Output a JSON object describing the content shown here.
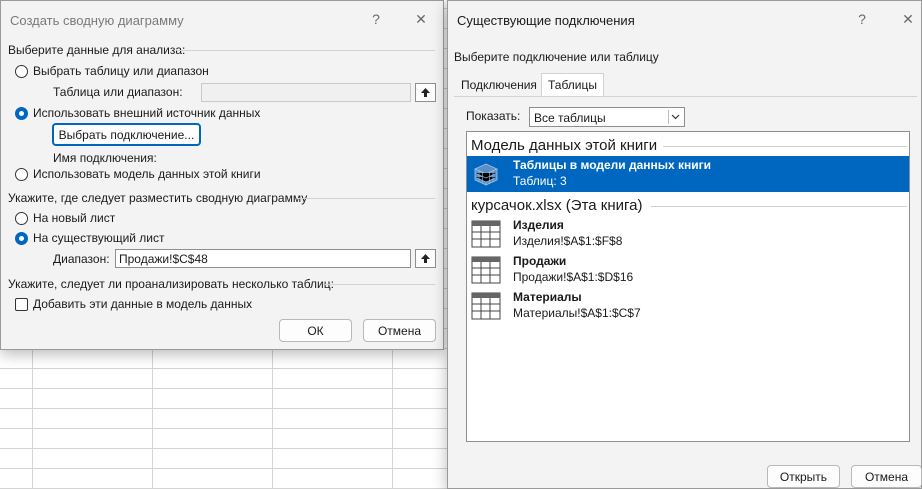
{
  "create_pivot_chart_dialog": {
    "title": "Создать сводную диаграмму",
    "help_glyph": "?",
    "close_glyph": "✕",
    "section_data": "Выберите данные для анализа:",
    "option_table_range": "Выбрать таблицу или диапазон",
    "table_range_label": "Таблица или диапазон:",
    "table_range_value": "",
    "option_external": "Использовать внешний источник данных",
    "choose_connection_button": "Выбрать подключение...",
    "connection_name_label": "Имя подключения:",
    "option_data_model": "Использовать модель данных этой книги",
    "section_location": "Укажите, где следует разместить сводную диаграмму",
    "option_new_sheet": "На новый лист",
    "option_existing_sheet": "На существующий лист",
    "range_label": "Диапазон:",
    "range_value": "Продажи!$C$48",
    "section_multiple": "Укажите, следует ли проанализировать несколько таблиц:",
    "add_to_model_label": "Добавить эти данные в модель данных",
    "ok_button": "ОК",
    "cancel_button": "Отмена"
  },
  "existing_connections_dialog": {
    "title": "Существующие подключения",
    "help_glyph": "?",
    "close_glyph": "✕",
    "prompt": "Выберите подключение или таблицу",
    "tabs": [
      {
        "label": "Подключения",
        "active": false
      },
      {
        "label": "Таблицы",
        "active": true
      }
    ],
    "show_label": "Показать:",
    "show_value": "Все таблицы",
    "groups": [
      {
        "header": "Модель данных этой книги",
        "items": [
          {
            "name": "Таблицы в модели данных книги",
            "sub": "Таблиц: 3",
            "icon": "data-model-cube-icon",
            "selected": true
          }
        ]
      },
      {
        "header": "курсачок.xlsx (Эта книга)",
        "items": [
          {
            "name": "Изделия",
            "sub": "Изделия!$A$1:$F$8",
            "icon": "table-icon",
            "selected": false
          },
          {
            "name": "Продажи",
            "sub": "Продажи!$A$1:$D$16",
            "icon": "table-icon",
            "selected": false
          },
          {
            "name": "Материалы",
            "sub": "Материалы!$A$1:$C$7",
            "icon": "table-icon",
            "selected": false
          }
        ]
      }
    ],
    "open_button": "Открыть",
    "cancel_button": "Отмена"
  },
  "colors": {
    "accent": "#0067c0",
    "dialog_bg": "#f3f3f3",
    "selection_text": "#ffffff"
  }
}
